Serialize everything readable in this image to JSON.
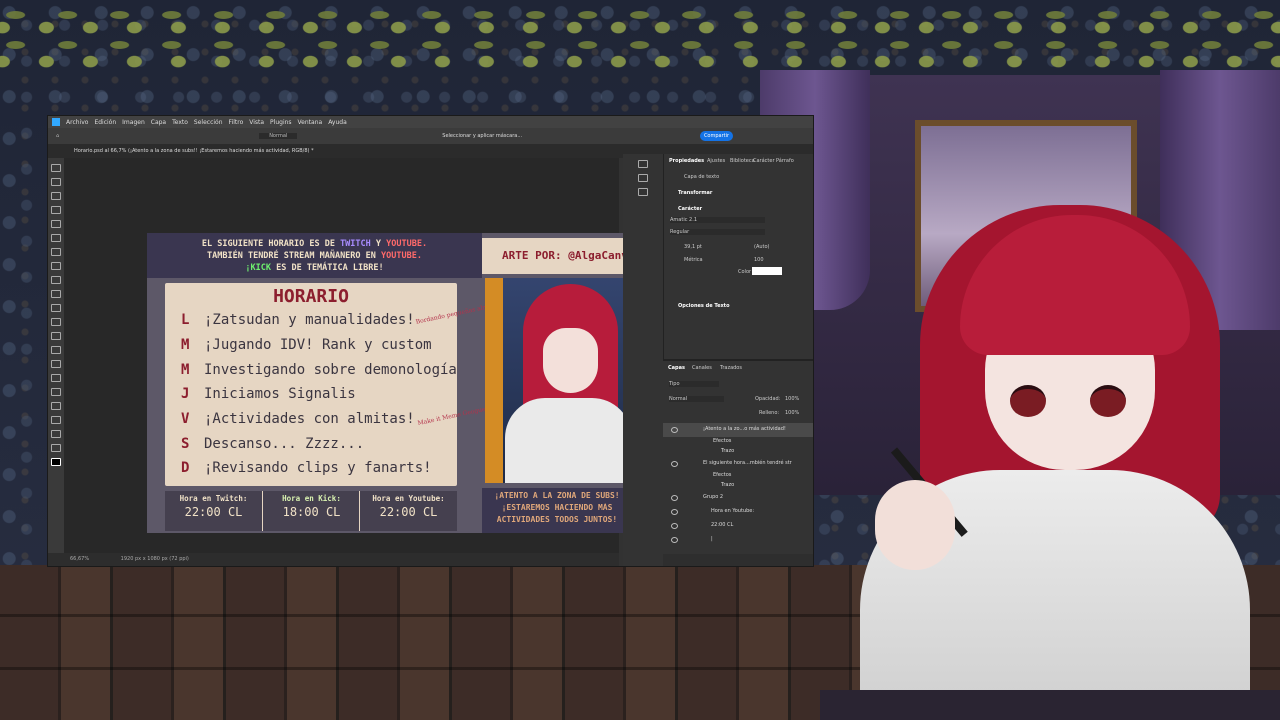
{
  "menu": [
    "Archivo",
    "Edición",
    "Imagen",
    "Capa",
    "Texto",
    "Selección",
    "Filtro",
    "Vista",
    "Plugins",
    "Ventana",
    "Ayuda"
  ],
  "options_bar": {
    "blend_mode": "Normal",
    "select_action": "Seleccionar y aplicar máscara..."
  },
  "share_button": "Compartir",
  "doc_tab": "Horario.psd al 66,7% (¡Atento a la zona de subs!! ¡Estaremos haciendo más actividad, RGB/8) *",
  "status": {
    "zoom": "66,67%",
    "dims": "1920 px x 1080 px (72 ppi)"
  },
  "properties": {
    "tabs": [
      "Propiedades",
      "Ajustes",
      "Biblioteca",
      "Carácter",
      "Párrafo"
    ],
    "layer_type": "Capa de texto",
    "transform": "Transformar",
    "character": "Carácter",
    "font": "Amatic 2.1",
    "style": "Regular",
    "size": "39,1 pt",
    "leading": "(Auto)",
    "kerning": "Métrica",
    "tracking": "100",
    "color_label": "Color",
    "text_options": "Opciones de Texto"
  },
  "layers_panel": {
    "tabs": [
      "Capas",
      "Canales",
      "Trazados"
    ],
    "filter": "Tipo",
    "blend": "Normal",
    "opacity_label": "Opacidad:",
    "opacity": "100%",
    "fill_label": "Relleno:",
    "fill": "100%",
    "rows": [
      "¡Atento a la zo...o más actividad!",
      "Efectos",
      "Trazo",
      "El siguiente hora...mbién tendré str",
      "Efectos",
      "Trazo",
      "Grupo 2",
      "Hora en Youtube:",
      "22:00 CL",
      "|"
    ]
  },
  "artwork": {
    "line1": {
      "pre": "EL SIGUIENTE HORARIO ES DE ",
      "a": "TWITCH",
      "mid": " Y ",
      "b": "YOUTUBE."
    },
    "line2": {
      "pre": "TAMBIÉN TENDRÉ STREAM MAÑANERO EN ",
      "a": "YOUTUBE."
    },
    "line3": {
      "a": "¡KICK",
      "post": " ES DE TEMÁTICA LIBRE!"
    },
    "title": "HORARIO",
    "days": [
      {
        "letter": "L",
        "text": "¡Zatsudan y manualidades!"
      },
      {
        "letter": "M",
        "text": "¡Jugando IDV! Rank y custom"
      },
      {
        "letter": "M",
        "text": "Investigando sobre demonología"
      },
      {
        "letter": "J",
        "text": "Iniciamos Signalis"
      },
      {
        "letter": "V",
        "text": "¡Actividades con almitas!"
      },
      {
        "letter": "S",
        "text": "Descanso... Zzzz..."
      },
      {
        "letter": "D",
        "text": "¡Revisando clips y fanarts!"
      }
    ],
    "note1": "Bordando pequeñas almitas",
    "note2": "Make it Meme Geoguessr",
    "times": [
      {
        "label": "Hora en Twitch:",
        "value": "22:00 CL"
      },
      {
        "label": "Hora en Kick:",
        "value": "18:00 CL"
      },
      {
        "label": "Hora en Youtube:",
        "value": "22:00 CL"
      }
    ],
    "art_credit": "ARTE POR: @AlgaCanvas",
    "foot": [
      "¡ATENTO A LA ZONA DE SUBS!",
      "¡ESTAREMOS HACIENDO MÁS",
      "ACTIVIDADES TODOS JUNTOS!"
    ]
  }
}
